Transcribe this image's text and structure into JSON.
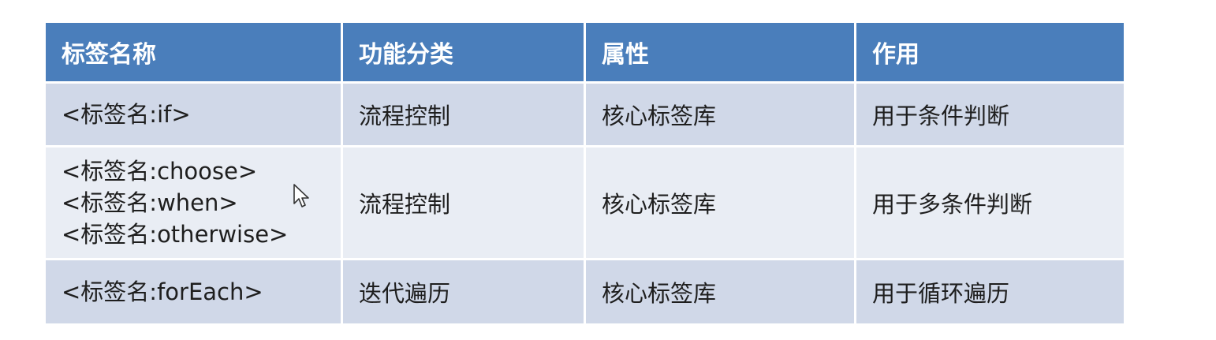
{
  "table": {
    "headers": [
      "标签名称",
      "功能分类",
      "属性",
      "作用"
    ],
    "rows": [
      {
        "tags": [
          "<标签名:if>"
        ],
        "category": "流程控制",
        "attribute": "核心标签库",
        "purpose": "用于条件判断"
      },
      {
        "tags": [
          "<标签名:choose>",
          "<标签名:when>",
          "<标签名:otherwise>"
        ],
        "category": "流程控制",
        "attribute": "核心标签库",
        "purpose": "用于多条件判断"
      },
      {
        "tags": [
          "<标签名:forEach>"
        ],
        "category": "迭代遍历",
        "attribute": "核心标签库",
        "purpose": "用于循环遍历"
      }
    ]
  },
  "colors": {
    "header_bg": "#4a7ebb",
    "row_odd_bg": "#d0d8e8",
    "row_even_bg": "#e9edf4"
  },
  "icons": {
    "cursor": "mouse-pointer-icon"
  }
}
